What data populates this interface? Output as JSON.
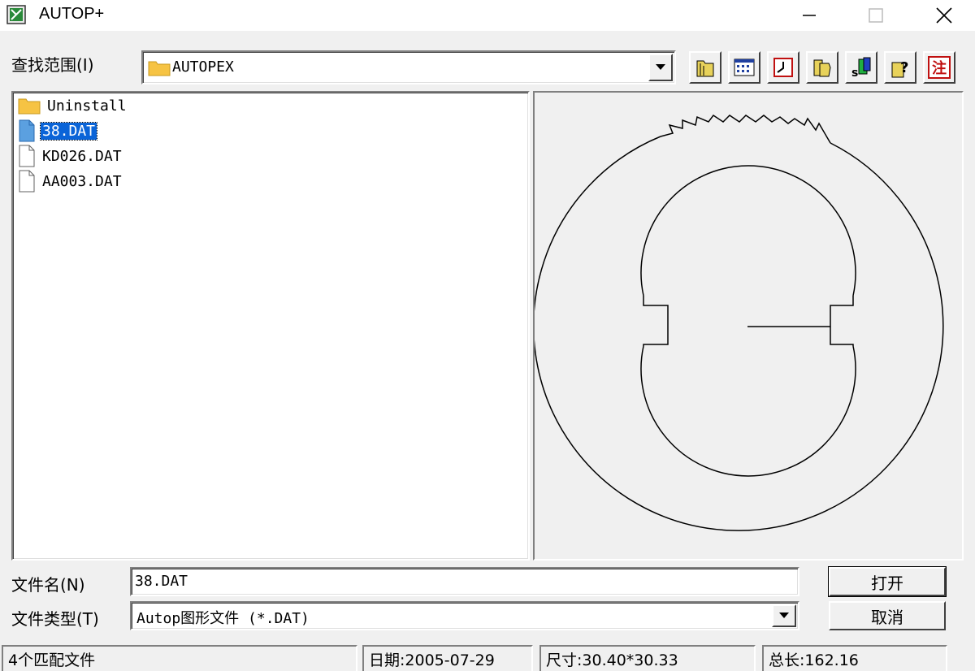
{
  "window": {
    "title": "AUTOP+",
    "icons": {
      "app": "autop-app-icon",
      "minimize": "minimize-icon",
      "maximize": "maximize-icon",
      "close": "close-icon"
    }
  },
  "lookin": {
    "label": "查找范围(I)",
    "value": "AUTOPEX",
    "icon": "folder-icon"
  },
  "toolbar": [
    {
      "name": "up-folder-icon"
    },
    {
      "name": "list-view-icon"
    },
    {
      "name": "clock-icon"
    },
    {
      "name": "copy-icon"
    },
    {
      "name": "settings-icon"
    },
    {
      "name": "help-icon"
    },
    {
      "name": "note-icon",
      "text": "注"
    }
  ],
  "files": [
    {
      "name": "Uninstall",
      "type": "folder",
      "selected": false
    },
    {
      "name": "38.DAT",
      "type": "file",
      "selected": true
    },
    {
      "name": "KD026.DAT",
      "type": "file",
      "selected": false
    },
    {
      "name": "AA003.DAT",
      "type": "file",
      "selected": false
    }
  ],
  "filename": {
    "label": "文件名(N)",
    "value": "38.DAT"
  },
  "filetype": {
    "label": "文件类型(T)",
    "value": "Autop图形文件 (*.DAT)"
  },
  "buttons": {
    "open": "打开",
    "cancel": "取消"
  },
  "status": {
    "count": "4个匹配文件",
    "date": "日期:2005-07-29",
    "size": "尺寸:30.40*30.33",
    "length": "总长:162.16"
  },
  "colors": {
    "selection": "#0a64d8",
    "folder": "#f6c343",
    "note": "#d01818"
  }
}
